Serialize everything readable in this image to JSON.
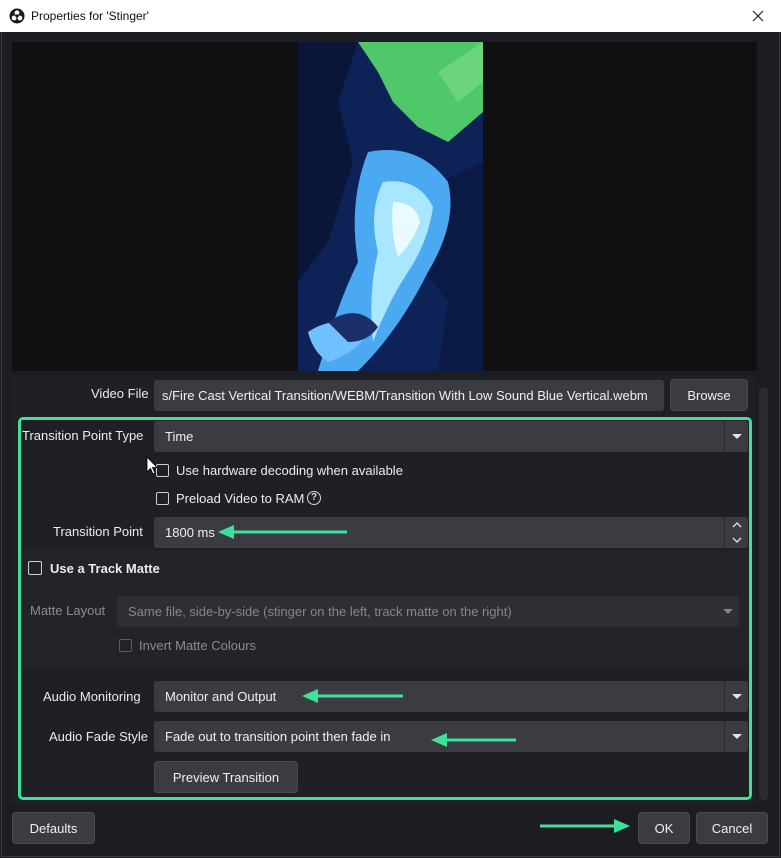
{
  "window": {
    "title": "Properties for 'Stinger'"
  },
  "fields": {
    "video_file": {
      "label": "Video File",
      "value": "s/Fire Cast Vertical Transition/WEBM/Transition With Low Sound Blue Vertical.webm",
      "browse_label": "Browse"
    },
    "transition_point_type": {
      "label": "Transition Point Type",
      "value": "Time"
    },
    "hardware_decoding": {
      "label": "Use hardware decoding when available",
      "checked": false
    },
    "preload_video": {
      "label": "Preload Video to RAM",
      "checked": false
    },
    "transition_point": {
      "label": "Transition Point",
      "value": "1800 ms"
    },
    "track_matte": {
      "label": "Use a Track Matte",
      "checked": false
    },
    "matte_layout": {
      "label": "Matte Layout",
      "value": "Same file, side-by-side (stinger on the left, track matte on the right)"
    },
    "invert_matte": {
      "label": "Invert Matte Colours",
      "checked": false
    },
    "audio_monitoring": {
      "label": "Audio Monitoring",
      "value": "Monitor and Output"
    },
    "audio_fade_style": {
      "label": "Audio Fade Style",
      "value": "Fade out to transition point then fade in"
    },
    "preview_transition_label": "Preview Transition"
  },
  "footer": {
    "defaults_label": "Defaults",
    "ok_label": "OK",
    "cancel_label": "Cancel"
  },
  "colors": {
    "annotation": "#3fe19a",
    "background": "#1c1d22",
    "field": "#3b3c42"
  },
  "icons": {
    "app": "obs-logo-icon",
    "close": "close-icon",
    "help": "help-icon",
    "dropdown": "chevron-down-icon"
  }
}
